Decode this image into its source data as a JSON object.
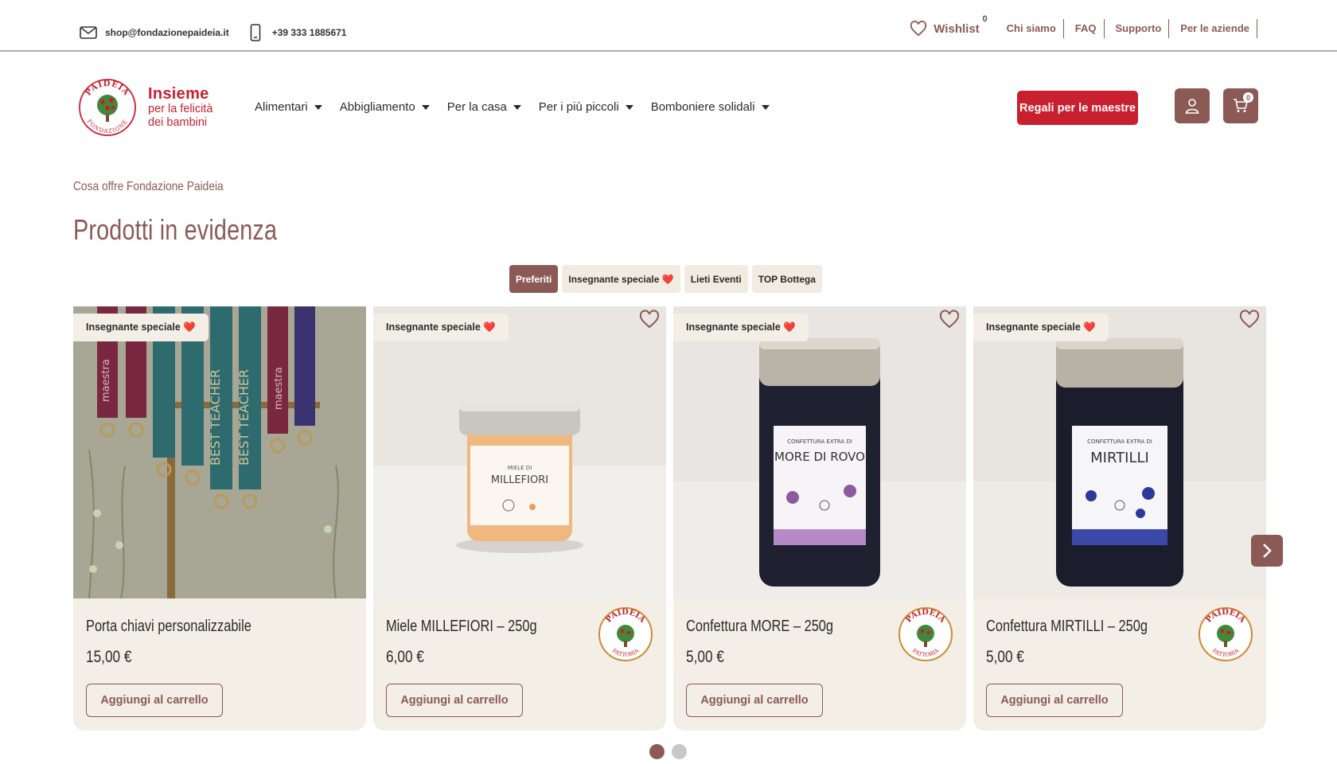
{
  "topbar": {
    "email": "shop@fondazionepaideia.it",
    "phone": "+39 333 1885671",
    "wishlist_label": "Wishlist",
    "wishlist_count": "0",
    "links": [
      "Chi siamo",
      "FAQ",
      "Supporto",
      "Per le aziende"
    ]
  },
  "brand": {
    "title": "Insieme",
    "subtitle_line1": "per la felicità",
    "subtitle_line2": "dei bambini",
    "logo_arc_top": "PAIDEIA",
    "logo_arc_bottom": "FONDAZIONE"
  },
  "nav": {
    "items": [
      "Alimentari",
      "Abbigliamento",
      "Per la casa",
      "Per i più piccoli",
      "Bomboniere solidali"
    ]
  },
  "header": {
    "cta_label": "Regali per le maestre",
    "cart_count": "0",
    "icons": [
      "user-icon",
      "cart-icon"
    ]
  },
  "section": {
    "kicker": "Cosa offre Fondazione Paideia",
    "title": "Prodotti in evidenza"
  },
  "tabs": [
    {
      "label": "Preferiti",
      "active": true
    },
    {
      "label": "Insegnante speciale ❤️",
      "active": false
    },
    {
      "label": "Lieti Eventi",
      "active": false
    },
    {
      "label": "TOP Bottega",
      "active": false
    }
  ],
  "products": [
    {
      "badge": "Insegnante speciale ❤️",
      "title": "Porta chiavi personalizzabile",
      "price": "15,00 €",
      "button": "Aggiungi al carrello",
      "image": "lanyards-photo",
      "image_text": [
        "maestra",
        "BEST TEACHER",
        "BEST TEACHER",
        "maestra"
      ]
    },
    {
      "badge": "Insegnante speciale ❤️",
      "title": "Miele MILLEFIORI – 250g",
      "price": "6,00 €",
      "button": "Aggiungi al carrello",
      "image": "honey-jar-photo",
      "label_line1": "MIELE DI",
      "label_line2": "MILLEFIORI",
      "farm_logo_top": "PAIDEIA",
      "farm_logo_bottom": "FATTORIA"
    },
    {
      "badge": "Insegnante speciale ❤️",
      "title": "Confettura MORE – 250g",
      "price": "5,00 €",
      "button": "Aggiungi al carrello",
      "image": "blackberry-jar-photo",
      "label_line1": "CONFETTURA EXTRA DI",
      "label_line2": "MORE DI ROVO",
      "farm_logo_top": "PAIDEIA",
      "farm_logo_bottom": "FATTORIA"
    },
    {
      "badge": "Insegnante speciale ❤️",
      "title": "Confettura MIRTILLI – 250g",
      "price": "5,00 €",
      "button": "Aggiungi al carrello",
      "image": "blueberry-jar-photo",
      "label_line1": "CONFETTURA EXTRA DI",
      "label_line2": "MIRTILLI",
      "farm_logo_top": "PAIDEIA",
      "farm_logo_bottom": "FATTORIA"
    }
  ],
  "carousel": {
    "page_count": 2,
    "active_page": 1
  },
  "colors": {
    "brand_brown": "#8b5a55",
    "brand_red": "#c8202f",
    "card_bg": "#f3eee6"
  }
}
